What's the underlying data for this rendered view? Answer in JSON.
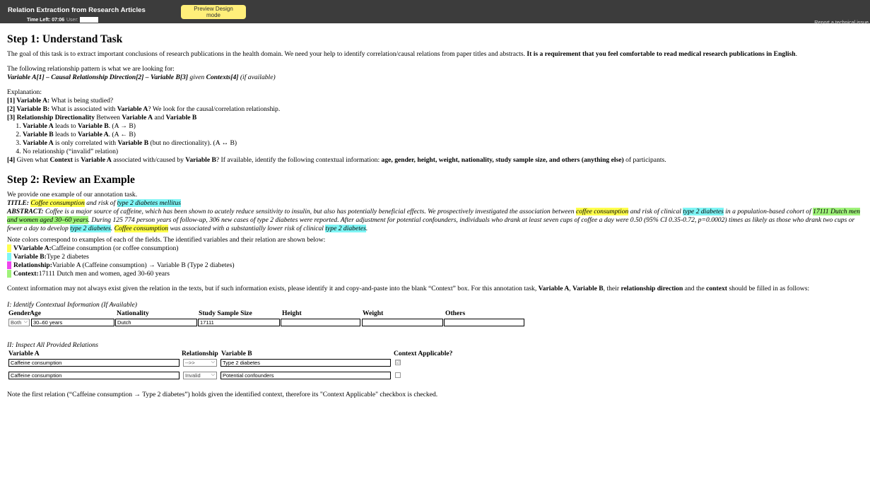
{
  "topbar": {
    "app_title": "Relation Extraction from Research Articles",
    "preview_label": "Preview Design mode",
    "time_left": "Time Left: 07:06",
    "user_label": "User:",
    "report_link": "Report a technical issue"
  },
  "step1": {
    "title": "Step 1: Understand Task",
    "goal_text": "The goal of this task is to extract important conclusions of research publications in the health domain. We need your help to identify correlation/causal relations from paper titles and abstracts. ",
    "goal_bold": "It is a requirement that you feel comfortable to read medical research publications in English",
    "goal_end": ".",
    "pattern_intro": "The following relationship pattern is what we are looking for:",
    "pattern_a": "Variable A[1] – Causal Relationship Direction[2] – Variable B[3]",
    "pattern_given": " given ",
    "pattern_ctx": "Contexts[4]",
    "pattern_avail": " (if available)",
    "explanation_label": "Explanation:",
    "exp1_num": "[1] ",
    "exp1_bold": "Variable A:",
    "exp1_text": " What is being studied?",
    "exp2_num": "[2] ",
    "exp2_bold": "Variable B:",
    "exp2_text1": " What is associated with ",
    "exp2_bold2": "Variable A",
    "exp2_text2": "? We look for the causal/correlation relationship.",
    "exp3_num": "[3] ",
    "exp3_bold": "Relationship Directionality",
    "exp3_text": " Between ",
    "exp3_va": "Variable A",
    "exp3_and": " and ",
    "exp3_vb": "Variable B",
    "dir_items": [
      {
        "a": "Variable A",
        "mid": " leads to ",
        "b": "Variable B",
        "end": ". (A → B)"
      },
      {
        "a": "Variable B",
        "mid": " leads to ",
        "b": "Variable A",
        "end": ". (A ← B)"
      },
      {
        "a": "Variable A",
        "mid": " is only correlated with ",
        "b": "Variable B",
        "end": " (but no directionality). (A ↔ B)"
      },
      {
        "a": "",
        "mid": "No relationship (“invalid” relation)",
        "b": "",
        "end": ""
      }
    ],
    "exp4_num": "[4]",
    "exp4_t1": " Given what ",
    "exp4_b1": "Context",
    "exp4_t2": " is ",
    "exp4_b2": "Variable A",
    "exp4_t3": " associated with/caused by ",
    "exp4_b3": "Variable B",
    "exp4_t4": "? If available, identify the following contextual information: ",
    "exp4_b4": "age, gender, height, weight, nationality, study sample size, and others (anything else)",
    "exp4_t5": " of participants."
  },
  "step2": {
    "title": "Step 2: Review an Example",
    "intro": "We provide one example of our annotation task.",
    "title_label": "TITLE:",
    "title_a": "Coffee consumption",
    "title_mid": " and risk of ",
    "title_b": "type 2 diabetes mellitus",
    "abstract_label": "ABSTRACT:",
    "abs1": " Coffee is a major source of caffeine, which has been shown to acutely reduce sensitivity to insulin, but also has potentially beneficial effects. We prospectively investigated the association between ",
    "abs_hl1": "coffee consumption",
    "abs2": " and risk of clinical ",
    "abs_hl2": "type 2 diabetes",
    "abs3": " in a population-based cohort of ",
    "abs_hl3": "17111 Dutch men and women aged 30–60 years",
    "abs4": ". During 125 774 person years of follow-up, 306 new cases of type 2 diabetes were reported. After adjustment for potential confounders, individuals who drank at least seven cups of coffee a day were 0.50 (95% CI 0.35-0.72, p=0.0002) times as likely as those who drank two cups or fewer a day to develop ",
    "abs_hl4": "type 2 diabetes",
    "abs5": ". ",
    "abs_hl5": "Coffee consumption",
    "abs6": " was associated with a substantially lower risk of clinical ",
    "abs_hl6": "type 2 diabetes",
    "abs7": ".",
    "note_colors": "Note colors correspond to examples of each of the fields. The identified variables and their relation are shown below:",
    "legend": [
      {
        "label": "VVariable A:",
        "text": " Caffeine consumption (or coffee consumption)",
        "color": "#ffff4d"
      },
      {
        "label": "Variable B:",
        "text": " Type 2 diabetes",
        "color": "#7ff5f5"
      },
      {
        "label": "Relationship:",
        "text": "  Variable A (Caffeine consumption) → Variable B (Type 2 diabetes)",
        "color": "#ee44ee"
      },
      {
        "label": "Context:",
        "text": " 17111 Dutch men and women, aged 30-60 years",
        "color": "#9ff27a"
      }
    ],
    "ctx_info1": "Context information may not always exist given the relation in the texts, but if such information exists, please identify it and copy-and-paste into the blank “Context” box. For this annotation task, ",
    "ctx_b1": "Variable A",
    "ctx_c1": ", ",
    "ctx_b2": "Variable B",
    "ctx_c2": ", their ",
    "ctx_b3": "relationship direction",
    "ctx_c3": " and the ",
    "ctx_b4": "context",
    "ctx_info2": " should be filled in as follows:",
    "form1_title": "I: Identify Contextual Information (If Available)",
    "form1_headers": {
      "gender": "Gender",
      "age": "Age",
      "nationality": "Nationality",
      "sample": "Study Sample Size",
      "height": "Height",
      "weight": "Weight",
      "others": "Others"
    },
    "form1_values": {
      "gender": "Both",
      "age": "30–60 years",
      "nationality": "Dutch",
      "sample": "17111",
      "height": "",
      "weight": "",
      "others": ""
    },
    "form2_title": "II: Inspect All Provided Relations",
    "form2_headers": {
      "va": "Variable A",
      "rel": "Relationship",
      "vb": "Variable B",
      "ctx": "Context Applicable?"
    },
    "relations": [
      {
        "va": "Caffeine consumption",
        "rel": "-->>",
        "vb": "Type 2 diabetes",
        "checked": "☑"
      },
      {
        "va": "Caffeine consumption",
        "rel": "Invalid",
        "vb": "Potential confounders",
        "checked": ""
      }
    ],
    "final_note": "Note the first relation (“Caffeine consumption → Type 2 diabetes”) holds given the identified context, therefore its \"Context Applicable\" checkbox is checked."
  }
}
